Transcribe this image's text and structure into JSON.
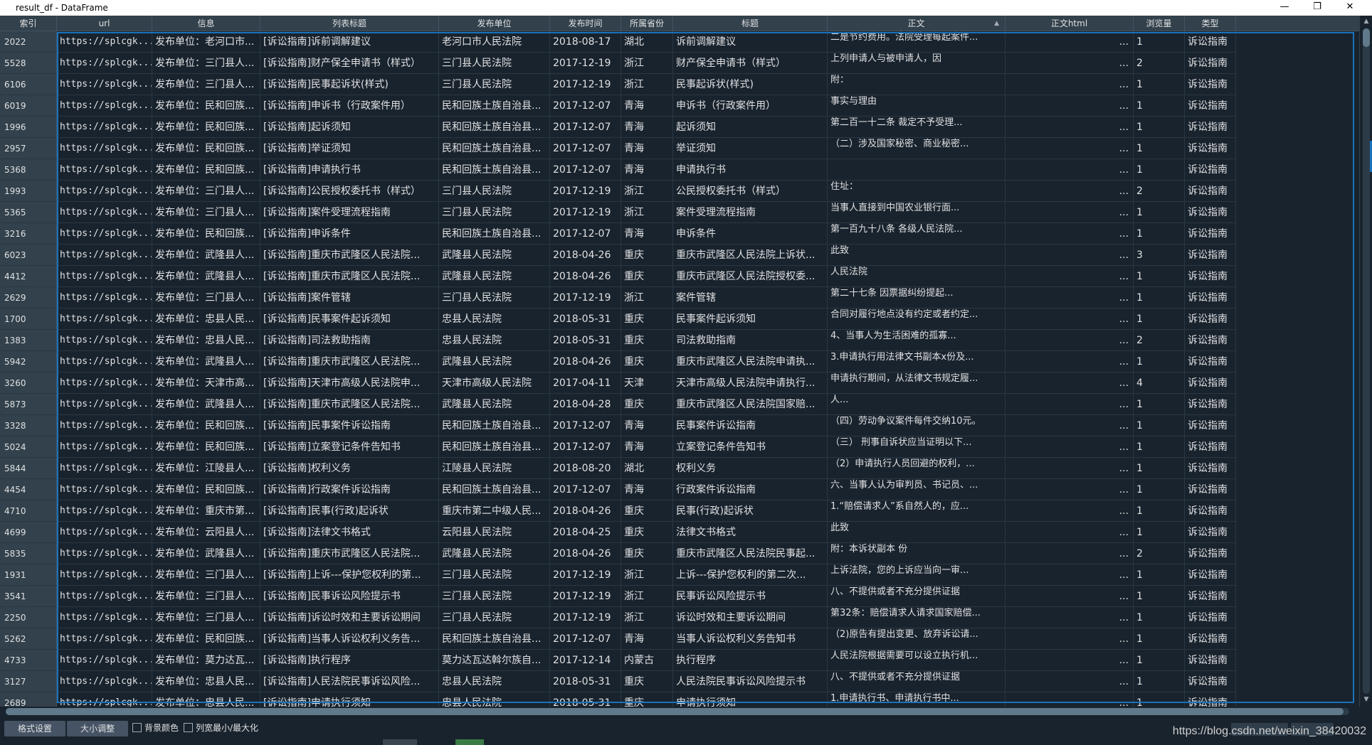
{
  "window": {
    "title": "result_df - DataFrame",
    "minimize": "—",
    "maximize": "❐",
    "close": "✕"
  },
  "columns": [
    "索引",
    "url",
    "信息",
    "列表标题",
    "发布单位",
    "发布时间",
    "所属省份",
    "标题",
    "正文",
    "正文html",
    "浏览量",
    "类型"
  ],
  "rows": [
    {
      "idx": "2022",
      "url": "https://splcgk...",
      "info": "发布单位：老河口市...",
      "list_title": "[诉讼指南]诉前调解建议",
      "unit": "老河口市人民法院",
      "date": "2018-08-17",
      "prov": "湖北",
      "title": "诉前调解建议",
      "body1": "二是节约费用。法院受理每起案件...",
      "body2": "",
      "views": "1",
      "type": "诉讼指南"
    },
    {
      "idx": "5528",
      "url": "https://splcgk...",
      "info": "发布单位：三门县人...",
      "list_title": "[诉讼指南]财产保全申请书（样式）",
      "unit": "三门县人民法院",
      "date": "2017-12-19",
      "prov": "浙江",
      "title": "财产保全申请书（样式）",
      "body1": "上列申请人与被申请人，因",
      "body2": "...",
      "views": "2",
      "type": "诉讼指南"
    },
    {
      "idx": "6106",
      "url": "https://splcgk...",
      "info": "发布单位：三门县人...",
      "list_title": "[诉讼指南]民事起诉状(样式)",
      "unit": "三门县人民法院",
      "date": "2017-12-19",
      "prov": "浙江",
      "title": "民事起诉状(样式)",
      "body1": "附：",
      "body2": "",
      "views": "1",
      "type": "诉讼指南"
    },
    {
      "idx": "6019",
      "url": "https://splcgk...",
      "info": "发布单位：民和回族...",
      "list_title": "[诉讼指南]申诉书（行政案件用）",
      "unit": "民和回族土族自治县...",
      "date": "2017-12-07",
      "prov": "青海",
      "title": "申诉书（行政案件用）",
      "body1": "事实与理由",
      "body2": "",
      "views": "1",
      "type": "诉讼指南"
    },
    {
      "idx": "1996",
      "url": "https://splcgk...",
      "info": "发布单位：民和回族...",
      "list_title": "[诉讼指南]起诉须知",
      "unit": "民和回族土族自治县...",
      "date": "2017-12-07",
      "prov": "青海",
      "title": "起诉须知",
      "body1": "第二百一十二条 裁定不予受理...",
      "body2": "",
      "views": "1",
      "type": "诉讼指南"
    },
    {
      "idx": "2957",
      "url": "https://splcgk...",
      "info": "发布单位：民和回族...",
      "list_title": "[诉讼指南]举证须知",
      "unit": "民和回族土族自治县...",
      "date": "2017-12-07",
      "prov": "青海",
      "title": "举证须知",
      "body1": "（二）涉及国家秘密、商业秘密...",
      "body2": "",
      "views": "1",
      "type": "诉讼指南"
    },
    {
      "idx": "5368",
      "url": "https://splcgk...",
      "info": "发布单位：民和回族...",
      "list_title": "[诉讼指南]申请执行书",
      "unit": "民和回族土族自治县...",
      "date": "2017-12-07",
      "prov": "青海",
      "title": "申请执行书",
      "body1": "",
      "body2": "...",
      "views": "1",
      "type": "诉讼指南"
    },
    {
      "idx": "1993",
      "url": "https://splcgk...",
      "info": "发布单位：三门县人...",
      "list_title": "[诉讼指南]公民授权委托书（样式）",
      "unit": "三门县人民法院",
      "date": "2017-12-19",
      "prov": "浙江",
      "title": "公民授权委托书（样式）",
      "body1": "住址：",
      "body2": "",
      "views": "2",
      "type": "诉讼指南"
    },
    {
      "idx": "5365",
      "url": "https://splcgk...",
      "info": "发布单位：三门县人...",
      "list_title": "[诉讼指南]案件受理流程指南",
      "unit": "三门县人民法院",
      "date": "2017-12-19",
      "prov": "浙江",
      "title": "案件受理流程指南",
      "body1": "当事人直接到中国农业银行面...",
      "body2": "",
      "views": "1",
      "type": "诉讼指南"
    },
    {
      "idx": "3216",
      "url": "https://splcgk...",
      "info": "发布单位：民和回族...",
      "list_title": "[诉讼指南]申诉条件",
      "unit": "民和回族土族自治县...",
      "date": "2017-12-07",
      "prov": "青海",
      "title": "申诉条件",
      "body1": "第一百九十八条 各级人民法院...",
      "body2": "",
      "views": "1",
      "type": "诉讼指南"
    },
    {
      "idx": "6023",
      "url": "https://splcgk...",
      "info": "发布单位：武隆县人...",
      "list_title": "[诉讼指南]重庆市武隆区人民法院...",
      "unit": "武隆县人民法院",
      "date": "2018-04-26",
      "prov": "重庆",
      "title": "重庆市武隆区人民法院上诉状...",
      "body1": "此致",
      "body2": "",
      "views": "3",
      "type": "诉讼指南"
    },
    {
      "idx": "4412",
      "url": "https://splcgk...",
      "info": "发布单位：武隆县人...",
      "list_title": "[诉讼指南]重庆市武隆区人民法院...",
      "unit": "武隆县人民法院",
      "date": "2018-04-26",
      "prov": "重庆",
      "title": "重庆市武隆区人民法院授权委...",
      "body1": "人民法院",
      "body2": "",
      "views": "1",
      "type": "诉讼指南"
    },
    {
      "idx": "2629",
      "url": "https://splcgk...",
      "info": "发布单位：三门县人...",
      "list_title": "[诉讼指南]案件管辖",
      "unit": "三门县人民法院",
      "date": "2017-12-19",
      "prov": "浙江",
      "title": "案件管辖",
      "body1": "第二十七条 因票据纠纷提起...",
      "body2": "",
      "views": "1",
      "type": "诉讼指南"
    },
    {
      "idx": "1700",
      "url": "https://splcgk...",
      "info": "发布单位：忠县人民...",
      "list_title": "[诉讼指南]民事案件起诉须知",
      "unit": "忠县人民法院",
      "date": "2018-05-31",
      "prov": "重庆",
      "title": "民事案件起诉须知",
      "body1": "合同对履行地点没有约定或者约定...",
      "body2": "",
      "views": "1",
      "type": "诉讼指南"
    },
    {
      "idx": "1383",
      "url": "https://splcgk...",
      "info": "发布单位：忠县人民...",
      "list_title": "[诉讼指南]司法救助指南",
      "unit": "忠县人民法院",
      "date": "2018-05-31",
      "prov": "重庆",
      "title": "司法救助指南",
      "body1": "4、当事人为生活困难的孤寡...",
      "body2": "",
      "views": "2",
      "type": "诉讼指南"
    },
    {
      "idx": "5942",
      "url": "https://splcgk...",
      "info": "发布单位：武隆县人...",
      "list_title": "[诉讼指南]重庆市武隆区人民法院...",
      "unit": "武隆县人民法院",
      "date": "2018-04-26",
      "prov": "重庆",
      "title": "重庆市武隆区人民法院申请执...",
      "body1": "3.申请执行用法律文书副本x份及...",
      "body2": "",
      "views": "1",
      "type": "诉讼指南"
    },
    {
      "idx": "3260",
      "url": "https://splcgk...",
      "info": "发布单位：天津市高...",
      "list_title": "[诉讼指南]天津市高级人民法院申...",
      "unit": "天津市高级人民法院",
      "date": "2017-04-11",
      "prov": "天津",
      "title": "天津市高级人民法院申请执行...",
      "body1": "申请执行期间，从法律文书规定履...",
      "body2": "",
      "views": "4",
      "type": "诉讼指南"
    },
    {
      "idx": "5873",
      "url": "https://splcgk...",
      "info": "发布单位：武隆县人...",
      "list_title": "[诉讼指南]重庆市武隆区人民法院...",
      "unit": "武隆县人民法院",
      "date": "2018-04-28",
      "prov": "重庆",
      "title": "重庆市武隆区人民法院国家赔...",
      "body1": "人...",
      "body2": "",
      "views": "1",
      "type": "诉讼指南"
    },
    {
      "idx": "3328",
      "url": "https://splcgk...",
      "info": "发布单位：民和回族...",
      "list_title": "[诉讼指南]民事案件诉讼指南",
      "unit": "民和回族土族自治县...",
      "date": "2017-12-07",
      "prov": "青海",
      "title": "民事案件诉讼指南",
      "body1": "（四）劳动争议案件每件交纳10元。",
      "body2": "",
      "views": "1",
      "type": "诉讼指南"
    },
    {
      "idx": "5024",
      "url": "https://splcgk...",
      "info": "发布单位：民和回族...",
      "list_title": "[诉讼指南]立案登记条件告知书",
      "unit": "民和回族土族自治县...",
      "date": "2017-12-07",
      "prov": "青海",
      "title": "立案登记条件告知书",
      "body1": "（三） 刑事自诉状应当证明以下...",
      "body2": "",
      "views": "1",
      "type": "诉讼指南"
    },
    {
      "idx": "5844",
      "url": "https://splcgk...",
      "info": "发布单位：江陵县人...",
      "list_title": "[诉讼指南]权利义务",
      "unit": "江陵县人民法院",
      "date": "2018-08-20",
      "prov": "湖北",
      "title": "权利义务",
      "body1": "（2）申请执行人员回避的权利，...",
      "body2": "",
      "views": "1",
      "type": "诉讼指南"
    },
    {
      "idx": "4454",
      "url": "https://splcgk...",
      "info": "发布单位：民和回族...",
      "list_title": "[诉讼指南]行政案件诉讼指南",
      "unit": "民和回族土族自治县...",
      "date": "2017-12-07",
      "prov": "青海",
      "title": "行政案件诉讼指南",
      "body1": "六、当事人认为审判员、书记员、...",
      "body2": "",
      "views": "1",
      "type": "诉讼指南"
    },
    {
      "idx": "4710",
      "url": "https://splcgk...",
      "info": "发布单位：重庆市第...",
      "list_title": "[诉讼指南]民事(行政)起诉状",
      "unit": "重庆市第二中级人民...",
      "date": "2018-04-26",
      "prov": "重庆",
      "title": "民事(行政)起诉状",
      "body1": "1.“赔偿请求人”系自然人的，应...",
      "body2": "",
      "views": "1",
      "type": "诉讼指南"
    },
    {
      "idx": "4699",
      "url": "https://splcgk...",
      "info": "发布单位：云阳县人...",
      "list_title": "[诉讼指南]法律文书格式",
      "unit": "云阳县人民法院",
      "date": "2018-04-25",
      "prov": "重庆",
      "title": "法律文书格式",
      "body1": "此致",
      "body2": "",
      "views": "1",
      "type": "诉讼指南"
    },
    {
      "idx": "5835",
      "url": "https://splcgk...",
      "info": "发布单位：武隆县人...",
      "list_title": "[诉讼指南]重庆市武隆区人民法院...",
      "unit": "武隆县人民法院",
      "date": "2018-04-26",
      "prov": "重庆",
      "title": "重庆市武隆区人民法院民事起...",
      "body1": "附：本诉状副本 份",
      "body2": "",
      "views": "2",
      "type": "诉讼指南"
    },
    {
      "idx": "1931",
      "url": "https://splcgk...",
      "info": "发布单位：三门县人...",
      "list_title": "[诉讼指南]上诉---保护您权利的第...",
      "unit": "三门县人民法院",
      "date": "2017-12-19",
      "prov": "浙江",
      "title": "上诉---保护您权利的第二次...",
      "body1": "上诉法院，您的上诉应当向一审...",
      "body2": "",
      "views": "1",
      "type": "诉讼指南"
    },
    {
      "idx": "3541",
      "url": "https://splcgk...",
      "info": "发布单位：三门县人...",
      "list_title": "[诉讼指南]民事诉讼风险提示书",
      "unit": "三门县人民法院",
      "date": "2017-12-19",
      "prov": "浙江",
      "title": "民事诉讼风险提示书",
      "body1": "八、不提供或者不充分提供证据",
      "body2": "",
      "views": "1",
      "type": "诉讼指南"
    },
    {
      "idx": "2250",
      "url": "https://splcgk...",
      "info": "发布单位：三门县人...",
      "list_title": "[诉讼指南]诉讼时效和主要诉讼期间",
      "unit": "三门县人民法院",
      "date": "2017-12-19",
      "prov": "浙江",
      "title": "诉讼时效和主要诉讼期间",
      "body1": "第32条：赔偿请求人请求国家赔偿...",
      "body2": "",
      "views": "1",
      "type": "诉讼指南"
    },
    {
      "idx": "5262",
      "url": "https://splcgk...",
      "info": "发布单位：民和回族...",
      "list_title": "[诉讼指南]当事人诉讼权利义务告...",
      "unit": "民和回族土族自治县...",
      "date": "2017-12-07",
      "prov": "青海",
      "title": "当事人诉讼权利义务告知书",
      "body1": "（2)原告有提出变更、放弃诉讼请...",
      "body2": "",
      "views": "1",
      "type": "诉讼指南"
    },
    {
      "idx": "4733",
      "url": "https://splcgk...",
      "info": "发布单位：莫力达瓦...",
      "list_title": "[诉讼指南]执行程序",
      "unit": "莫力达瓦达斡尔族自...",
      "date": "2017-12-14",
      "prov": "内蒙古",
      "title": "执行程序",
      "body1": "人民法院根据需要可以设立执行机...",
      "body2": "",
      "views": "1",
      "type": "诉讼指南"
    },
    {
      "idx": "3127",
      "url": "https://splcgk...",
      "info": "发布单位：忠县人民...",
      "list_title": "[诉讼指南]人民法院民事诉讼风险...",
      "unit": "忠县人民法院",
      "date": "2018-05-31",
      "prov": "重庆",
      "title": "人民法院民事诉讼风险提示书",
      "body1": "八、不提供或者不充分提供证据",
      "body2": "",
      "views": "1",
      "type": "诉讼指南"
    },
    {
      "idx": "2689",
      "url": "https://splcgk...",
      "info": "发布单位：忠县人民...",
      "list_title": "[诉讼指南]申请执行须知",
      "unit": "忠县人民法院",
      "date": "2018-05-31",
      "prov": "重庆",
      "title": "申请执行须知",
      "body1": "1.申请执行书、申请执行书中...",
      "body2": "",
      "views": "1",
      "type": "诉讼指南"
    }
  ],
  "html_ellipsis": "...",
  "toolbar": {
    "format_btn": "格式设置",
    "resize_btn": "大小调整",
    "bg_color_label": "背景颜色",
    "col_minmax_label": "列宽最小/最大化",
    "watermark": "https://blog.csdn.net/weixin_38420032"
  },
  "colors": {
    "background": "#19232d",
    "header": "#32414b",
    "selection": "#1a72bb",
    "text": "#e0e1e3"
  }
}
